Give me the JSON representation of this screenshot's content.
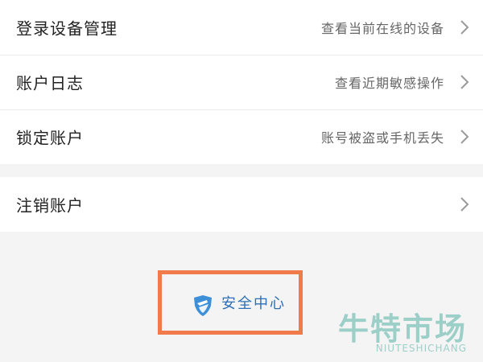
{
  "menu": {
    "items": [
      {
        "label": "登录设备管理",
        "desc": "查看当前在线的设备"
      },
      {
        "label": "账户日志",
        "desc": "查看近期敏感操作"
      },
      {
        "label": "锁定账户",
        "desc": "账号被盗或手机丢失"
      }
    ],
    "deactivate": {
      "label": "注销账户"
    }
  },
  "security_center": {
    "label": "安全中心",
    "icon": "shield-icon",
    "highlight_color": "#f07a4a",
    "text_color": "#2f6fb5"
  },
  "watermark": {
    "main": "牛特市场",
    "sub": "NIUTESHICHANG"
  },
  "icons": {
    "chevron": "chevron-right-icon"
  }
}
